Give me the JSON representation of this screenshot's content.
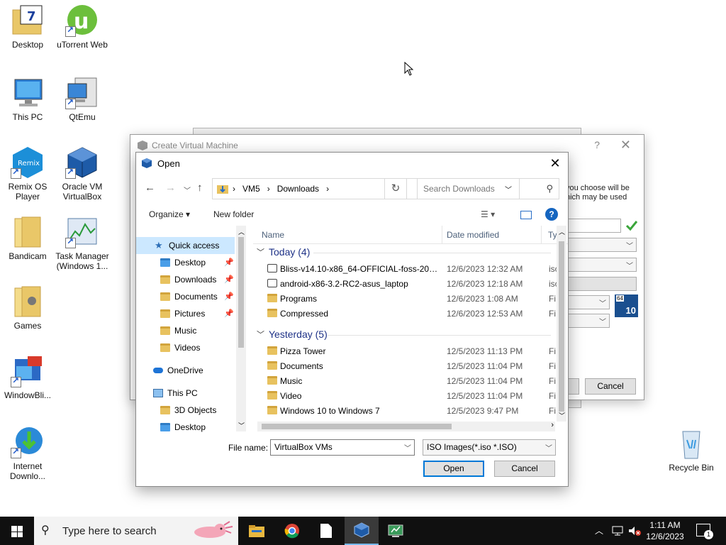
{
  "desktop": {
    "icons": [
      {
        "label": "Desktop",
        "icon": "desktop-folder-icon"
      },
      {
        "label": "uTorrent Web",
        "icon": "utorrent-icon"
      },
      {
        "label": "This PC",
        "icon": "this-pc-icon"
      },
      {
        "label": "QtEmu",
        "icon": "qtemu-icon"
      },
      {
        "label": "Remix OS Player",
        "icon": "remix-os-icon"
      },
      {
        "label": "Oracle VM VirtualBox",
        "icon": "virtualbox-icon"
      },
      {
        "label": "Bandicam",
        "icon": "bandicam-folder-icon"
      },
      {
        "label": "Task Manager (Windows 1...",
        "icon": "task-manager-icon"
      },
      {
        "label": "Games",
        "icon": "games-folder-icon"
      },
      {
        "label": "WindowBli...",
        "icon": "windowblinds-icon"
      },
      {
        "label": "Internet Downlo...",
        "icon": "internet-download-manager-icon"
      },
      {
        "label": "Recycle Bin",
        "icon": "recycle-bin-icon"
      }
    ]
  },
  "bg_window": {
    "title": "Create Virtual Machine",
    "help": "?",
    "close": "✕",
    "text1": "you choose will be",
    "text2": "hich may be used",
    "cancel": "Cancel",
    "os_badge": "10",
    "os_bits": "64"
  },
  "dialog": {
    "title": "Open",
    "close": "✕",
    "address": [
      "VM5",
      "Downloads"
    ],
    "search_placeholder": "Search Downloads",
    "organize": "Organize ▾",
    "new_folder": "New folder",
    "help": "?",
    "nav": [
      {
        "label": "Quick access",
        "selected": true
      },
      {
        "label": "Desktop",
        "pinned": true
      },
      {
        "label": "Downloads",
        "pinned": true
      },
      {
        "label": "Documents",
        "pinned": true
      },
      {
        "label": "Pictures",
        "pinned": true
      },
      {
        "label": "Music"
      },
      {
        "label": "Videos"
      },
      {
        "label": "OneDrive"
      },
      {
        "label": "This PC"
      },
      {
        "label": "3D Objects"
      },
      {
        "label": "Desktop"
      }
    ],
    "columns": {
      "name": "Name",
      "date": "Date modified",
      "type": "Ty"
    },
    "groups": [
      {
        "label": "Today (4)",
        "rows": [
          {
            "name": "Bliss-v14.10-x86_64-OFFICIAL-foss-20230...",
            "date": "12/6/2023 12:32 AM",
            "type": "isc",
            "kind": "iso"
          },
          {
            "name": "android-x86-3.2-RC2-asus_laptop",
            "date": "12/6/2023 12:18 AM",
            "type": "isc",
            "kind": "iso"
          },
          {
            "name": "Programs",
            "date": "12/6/2023 1:08 AM",
            "type": "Fi",
            "kind": "folder"
          },
          {
            "name": "Compressed",
            "date": "12/6/2023 12:53 AM",
            "type": "Fi",
            "kind": "folder"
          }
        ]
      },
      {
        "label": "Yesterday (5)",
        "rows": [
          {
            "name": "Pizza Tower",
            "date": "12/5/2023 11:13 PM",
            "type": "Fi",
            "kind": "folder"
          },
          {
            "name": "Documents",
            "date": "12/5/2023 11:04 PM",
            "type": "Fi",
            "kind": "folder"
          },
          {
            "name": "Music",
            "date": "12/5/2023 11:04 PM",
            "type": "Fi",
            "kind": "folder"
          },
          {
            "name": "Video",
            "date": "12/5/2023 11:04 PM",
            "type": "Fi",
            "kind": "folder"
          },
          {
            "name": "Windows 10 to Windows 7",
            "date": "12/5/2023 9:47 PM",
            "type": "Fi",
            "kind": "folder"
          }
        ]
      }
    ],
    "file_name_label": "File name:",
    "file_name_value": "VirtualBox VMs",
    "file_type_value": "ISO Images(*.iso *.ISO)",
    "open_label": "Open",
    "cancel_label": "Cancel"
  },
  "taskbar": {
    "search_placeholder": "Type here to search",
    "time": "1:11 AM",
    "date": "12/6/2023",
    "notification_count": "1",
    "apps": [
      "file-explorer-icon",
      "chrome-icon",
      "notepad-icon",
      "virtualbox-icon",
      "qtemu-icon"
    ]
  }
}
